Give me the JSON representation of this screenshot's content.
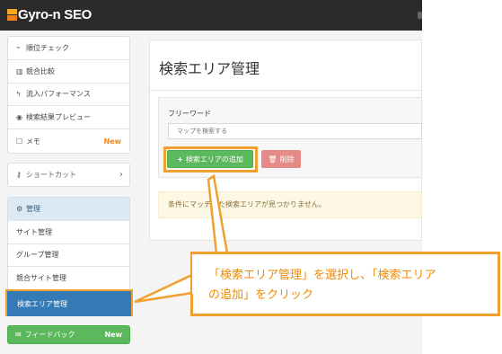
{
  "header": {
    "app_name": "Gyro-n SEO"
  },
  "sidebar": {
    "group1": [
      {
        "icon": "line-chart-icon",
        "glyph": "📈",
        "label": "順位チェック"
      },
      {
        "icon": "bar-chart-icon",
        "glyph": "▥",
        "label": "競合比較"
      },
      {
        "icon": "bolt-icon",
        "glyph": "ϟ",
        "label": "流入パフォーマンス"
      },
      {
        "icon": "eye-icon",
        "glyph": "◉",
        "label": "検索結果プレビュー"
      },
      {
        "icon": "memo-icon",
        "glyph": "☐",
        "label": "メモ",
        "badge": "New"
      }
    ],
    "shortcut": {
      "icon": "key-icon",
      "glyph": "⚷",
      "label": "ショートカット"
    },
    "manage": {
      "title": "管理",
      "items": [
        "サイト管理",
        "グループ管理",
        "競合サイト管理",
        "検索エリア管理"
      ]
    },
    "feedback": {
      "label": "フィードバック",
      "badge": "New"
    }
  },
  "main": {
    "title": "検索エリア管理",
    "freeword_label": "フリーワード",
    "search_placeholder": "マップを検索する",
    "add_button": "検索エリアの追加",
    "delete_button": "削除",
    "empty_message": "条件にマッチした検索エリアが見つかりません。"
  },
  "annotation": {
    "line1": "「検索エリア管理」を選択し、「検索エリア",
    "line2": "の追加」をクリック"
  },
  "colors": {
    "accent": "#f0a030",
    "primary": "#337ab7",
    "success": "#5cb85c",
    "danger": "#e58a87"
  }
}
